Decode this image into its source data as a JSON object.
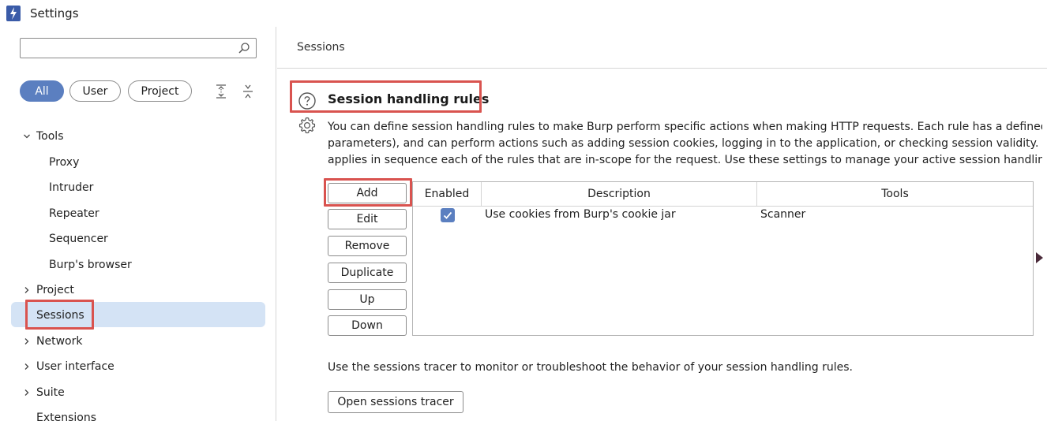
{
  "window": {
    "title": "Settings"
  },
  "search": {
    "placeholder": "",
    "value": ""
  },
  "filters": {
    "all": "All",
    "user": "User",
    "project": "Project",
    "active": "All"
  },
  "tree": {
    "tools": "Tools",
    "proxy": "Proxy",
    "intruder": "Intruder",
    "repeater": "Repeater",
    "sequencer": "Sequencer",
    "burps_browser": "Burp's browser",
    "project": "Project",
    "sessions": "Sessions",
    "network": "Network",
    "user_interface": "User interface",
    "suite": "Suite",
    "extensions": "Extensions",
    "selected": "Sessions"
  },
  "main": {
    "breadcrumb": "Sessions",
    "section_title": "Session handling rules",
    "description_lines": [
      "You can define session handling rules to make Burp perform specific actions when making HTTP requests. Each rule has a defined scope (f",
      "parameters), and can perform actions such as adding session cookies, logging in to the application, or checking session validity. Before eac",
      "applies in sequence each of the rules that are in-scope for the request. Use these settings to manage your active session handling rules."
    ],
    "buttons": {
      "add": "Add",
      "edit": "Edit",
      "remove": "Remove",
      "duplicate": "Duplicate",
      "up": "Up",
      "down": "Down"
    },
    "table": {
      "headers": {
        "enabled": "Enabled",
        "description": "Description",
        "tools": "Tools"
      },
      "rows": [
        {
          "enabled": true,
          "description": "Use cookies from Burp's cookie jar",
          "tools": "Scanner"
        }
      ]
    },
    "tracer_text": "Use the sessions tracer to monitor or troubleshoot the behavior of your session handling rules.",
    "tracer_button": "Open sessions tracer"
  },
  "colors": {
    "accent": "#5b7fc0",
    "highlight": "#d9534f",
    "selected_bg": "#d4e3f5"
  },
  "icons": {
    "app": "burp-lightning-icon",
    "search": "search-icon",
    "expand_all": "expand-all-icon",
    "collapse_all": "collapse-all-icon",
    "help": "help-circle-icon",
    "settings": "gear-icon",
    "checkbox": "check-icon"
  }
}
